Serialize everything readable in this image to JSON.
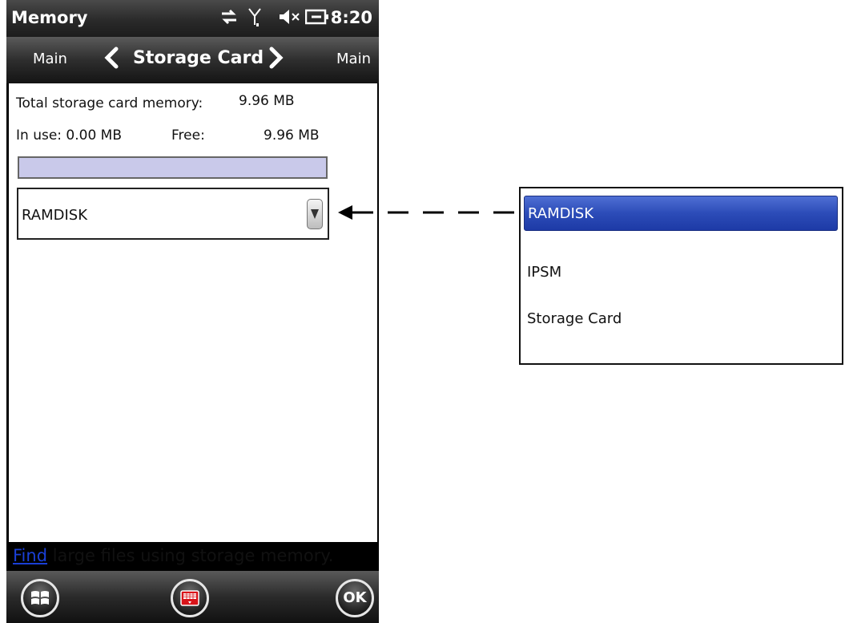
{
  "status_bar": {
    "app_title": "Memory",
    "time": "8:20",
    "icons": [
      "sync-arrows-icon",
      "signal-antenna-icon",
      "speaker-muted-icon",
      "battery-charging-icon"
    ]
  },
  "nav": {
    "prev_label": "Main",
    "title": "Storage Card",
    "next_label": "Main"
  },
  "memory": {
    "total_label": "Total storage card memory:",
    "total_value": "9.96 MB",
    "in_use_label": "In use: 0.00 MB",
    "free_label": "Free:",
    "free_value": "9.96 MB",
    "usage_fraction": 0
  },
  "dropdown": {
    "selected": "RAMDISK"
  },
  "popup_list": {
    "options": [
      "RAMDISK",
      "IPSM",
      "Storage Card"
    ],
    "selected_index": 0
  },
  "footer": {
    "link_text": "Find",
    "text": " large files using storage memory."
  },
  "bottom_bar": {
    "ok_label": "OK"
  },
  "colors": {
    "highlight": "#2c4cb8",
    "progress_track": "#c9c9ea",
    "link": "#1a3fd6"
  }
}
